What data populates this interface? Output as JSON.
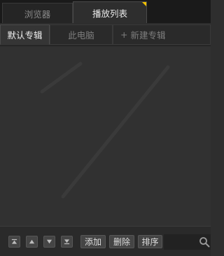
{
  "top_tabs": [
    {
      "label": "浏览器",
      "active": false
    },
    {
      "label": "播放列表",
      "active": true
    }
  ],
  "sub_tabs": [
    {
      "label": "默认专辑",
      "active": true
    },
    {
      "label": "此电脑",
      "active": false
    },
    {
      "label": "新建专辑",
      "prefix": "+",
      "active": false
    }
  ],
  "toolbar": {
    "add_label": "添加",
    "delete_label": "删除",
    "sort_label": "排序",
    "search_value": ""
  },
  "icons": {
    "move_top": "move-to-top-icon",
    "move_up": "move-up-icon",
    "move_down": "move-down-icon",
    "move_bottom": "move-to-bottom-icon",
    "search": "search-icon"
  },
  "colors": {
    "accent": "#f2c200",
    "panel": "#313131"
  }
}
